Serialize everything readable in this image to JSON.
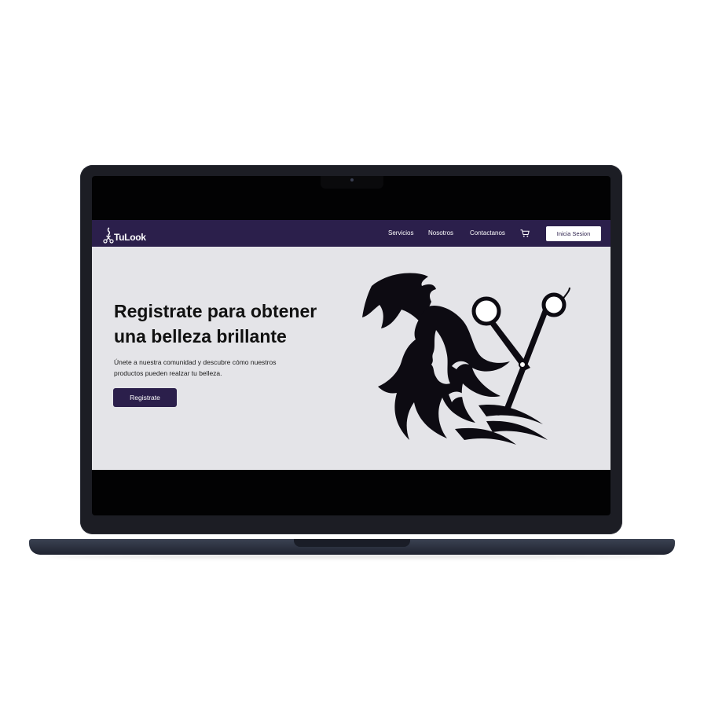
{
  "brand": {
    "name": "TuLook"
  },
  "nav": {
    "links": [
      "Servicios",
      "Nosotros",
      "Contactanos"
    ],
    "cart_icon": "cart-icon",
    "login_label": "Inicia Sesion"
  },
  "hero": {
    "title_line1": "Registrate para obtener",
    "title_line2": "una belleza brillante",
    "subtitle_line1": "Únete a nuestra comunidad y descubre cómo nuestros",
    "subtitle_line2": "productos pueden realzar tu belleza.",
    "cta_label": "Registrate",
    "illustration": "hair-silhouette-with-scissors"
  },
  "colors": {
    "nav_bg": "#2b1f4b",
    "page_bg": "#e4e4e8",
    "cta_bg": "#2b1f4b",
    "text": "#111111"
  }
}
